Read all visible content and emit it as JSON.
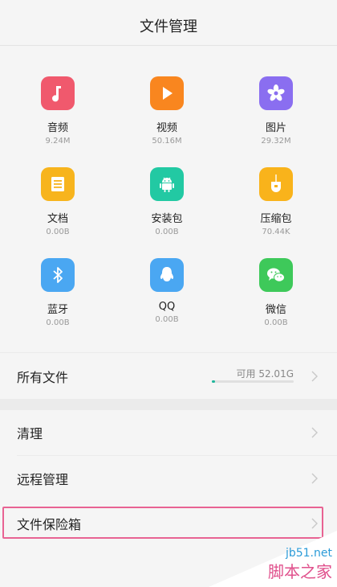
{
  "header": {
    "title": "文件管理"
  },
  "categories": [
    {
      "name": "音频",
      "size": "9.24M",
      "icon": "music-note-icon",
      "color": "#f0596d"
    },
    {
      "name": "视频",
      "size": "50.16M",
      "icon": "play-icon",
      "color": "#f9861f"
    },
    {
      "name": "图片",
      "size": "29.32M",
      "icon": "flower-icon",
      "color": "#8a6ef0"
    },
    {
      "name": "文档",
      "size": "0.00B",
      "icon": "document-icon",
      "color": "#f7b41d"
    },
    {
      "name": "安装包",
      "size": "0.00B",
      "icon": "android-icon",
      "color": "#22c9a3"
    },
    {
      "name": "压缩包",
      "size": "70.44K",
      "icon": "zip-icon",
      "color": "#f9b31b"
    },
    {
      "name": "蓝牙",
      "size": "0.00B",
      "icon": "bluetooth-icon",
      "color": "#4aa7f2"
    },
    {
      "name": "QQ",
      "size": "0.00B",
      "icon": "qq-icon",
      "color": "#4aa7f2"
    },
    {
      "name": "微信",
      "size": "0.00B",
      "icon": "wechat-icon",
      "color": "#3ec95a"
    }
  ],
  "all_files": {
    "label": "所有文件",
    "available": "可用 52.01G",
    "used_fraction": 0.04
  },
  "menu": [
    {
      "label": "清理"
    },
    {
      "label": "远程管理"
    },
    {
      "label": "文件保险箱"
    }
  ],
  "watermark": {
    "site": "jb51.net",
    "name": "脚本之家"
  }
}
